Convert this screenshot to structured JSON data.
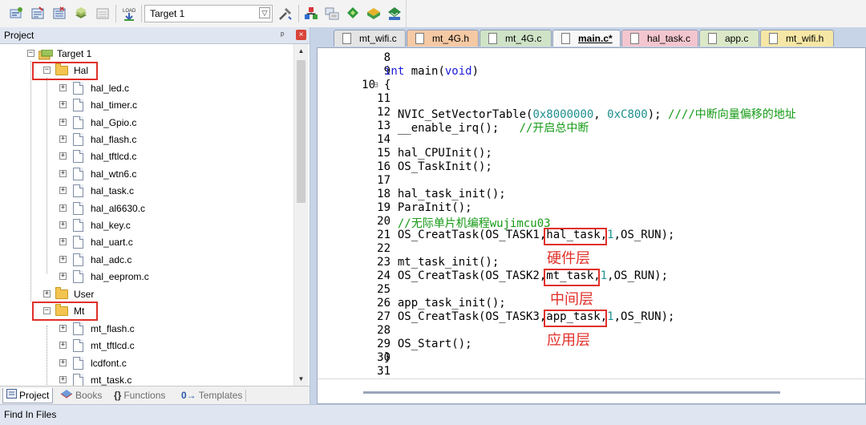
{
  "toolbar": {
    "target_name": "Target 1",
    "icons": [
      "translate-icon",
      "build-icon",
      "rebuild-icon",
      "batch-build-icon",
      "stop-build-icon",
      "load-icon",
      "options-icon",
      "manage-components-icon",
      "file-extensions-icon",
      "select-packs-icon",
      "pack-installer-icon",
      "run-time-env-icon"
    ]
  },
  "project_panel": {
    "title": "Project",
    "pin_symbol": "ᵖ",
    "close_symbol": "×",
    "tree": [
      {
        "label": "Target 1",
        "type": "target",
        "expander": "−"
      },
      {
        "label": "Hal",
        "type": "folder",
        "expander": "−"
      },
      {
        "label": "hal_led.c",
        "type": "file",
        "expander": "+"
      },
      {
        "label": "hal_timer.c",
        "type": "file",
        "expander": "+"
      },
      {
        "label": "hal_Gpio.c",
        "type": "file",
        "expander": "+"
      },
      {
        "label": "hal_flash.c",
        "type": "file",
        "expander": "+"
      },
      {
        "label": "hal_tftlcd.c",
        "type": "file",
        "expander": "+"
      },
      {
        "label": "hal_wtn6.c",
        "type": "file",
        "expander": "+"
      },
      {
        "label": "hal_task.c",
        "type": "file",
        "expander": "+"
      },
      {
        "label": "hal_al6630.c",
        "type": "file",
        "expander": "+"
      },
      {
        "label": "hal_key.c",
        "type": "file",
        "expander": "+"
      },
      {
        "label": "hal_uart.c",
        "type": "file",
        "expander": "+"
      },
      {
        "label": "hal_adc.c",
        "type": "file",
        "expander": "+"
      },
      {
        "label": "hal_eeprom.c",
        "type": "file",
        "expander": "+"
      },
      {
        "label": "User",
        "type": "folder",
        "expander": "+"
      },
      {
        "label": "Mt",
        "type": "folder",
        "expander": "−"
      },
      {
        "label": "mt_flash.c",
        "type": "file",
        "expander": "+"
      },
      {
        "label": "mt_tftlcd.c",
        "type": "file",
        "expander": "+"
      },
      {
        "label": "lcdfont.c",
        "type": "file",
        "expander": "+"
      },
      {
        "label": "mt_task.c",
        "type": "file",
        "expander": "+"
      }
    ],
    "bottom_tabs": [
      {
        "label": "Project",
        "icon": "project-icon",
        "active": true
      },
      {
        "label": "Books",
        "icon": "books-icon",
        "active": false
      },
      {
        "label": "Functions",
        "icon": "functions-icon",
        "glyph": "{}",
        "active": false
      },
      {
        "label": "Templates",
        "icon": "templates-icon",
        "glyph": "0→",
        "active": false
      }
    ]
  },
  "editor": {
    "tabs": [
      {
        "label": "mt_wifi.c",
        "color": "#e4e4e4",
        "active": false
      },
      {
        "label": "mt_4G.h",
        "color": "#f5c9a4",
        "active": false
      },
      {
        "label": "mt_4G.c",
        "color": "#cfe3c7",
        "active": false
      },
      {
        "label": "main.c*",
        "color": "#f7f7f7",
        "active": true
      },
      {
        "label": "hal_task.c",
        "color": "#f3c6cf",
        "active": false
      },
      {
        "label": "app.c",
        "color": "#dbe9c8",
        "active": false
      },
      {
        "label": "mt_wifi.h",
        "color": "#f6e7a6",
        "active": false
      }
    ],
    "lines": [
      {
        "n": "8",
        "code": ""
      },
      {
        "n": "9",
        "code": "int main(void)"
      },
      {
        "n": "10",
        "code": "{",
        "fold": "⊟"
      },
      {
        "n": "11",
        "code": ""
      },
      {
        "n": "12",
        "code": "  NVIC_SetVectorTable(0x8000000, 0xC800); ////中断向量偏移的地址"
      },
      {
        "n": "13",
        "code": "  __enable_irq();   //开启总中断"
      },
      {
        "n": "14",
        "code": ""
      },
      {
        "n": "15",
        "code": "  hal_CPUInit();"
      },
      {
        "n": "16",
        "code": "  OS_TaskInit();"
      },
      {
        "n": "17",
        "code": ""
      },
      {
        "n": "18",
        "code": "  hal_task_init();"
      },
      {
        "n": "19",
        "code": "  ParaInit();"
      },
      {
        "n": "20",
        "code": "  //无际单片机编程wujimcu03"
      },
      {
        "n": "21",
        "code": "  OS_CreatTask(OS_TASK1,hal_task,1,OS_RUN);"
      },
      {
        "n": "22",
        "code": ""
      },
      {
        "n": "23",
        "code": "  mt_task_init();"
      },
      {
        "n": "24",
        "code": "  OS_CreatTask(OS_TASK2,mt_task,1,OS_RUN);"
      },
      {
        "n": "25",
        "code": ""
      },
      {
        "n": "26",
        "code": "  app_task_init();"
      },
      {
        "n": "27",
        "code": "  OS_CreatTask(OS_TASK3,app_task,1,OS_RUN);"
      },
      {
        "n": "28",
        "code": ""
      },
      {
        "n": "29",
        "code": "  OS_Start();"
      },
      {
        "n": "30",
        "code": "}"
      },
      {
        "n": "31",
        "code": ""
      }
    ],
    "annotations": {
      "hardware_layer": "硬件层",
      "middle_layer": "中间层",
      "app_layer": "应用层"
    }
  },
  "find_bar": {
    "title": "Find In Files"
  },
  "colors": {
    "highlight_box": "#e0302a",
    "keyword": "#1b1bd8",
    "number": "#1f8f8f",
    "comment": "#159a15"
  }
}
